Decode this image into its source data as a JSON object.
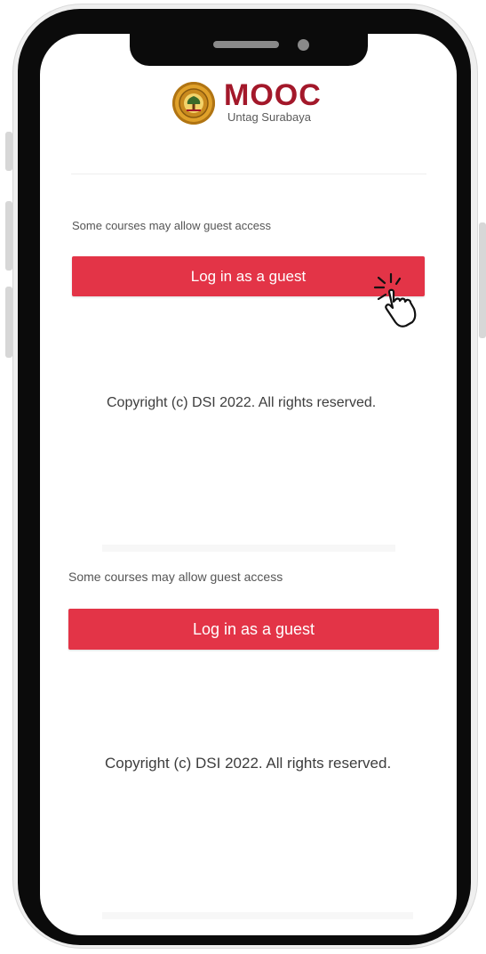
{
  "logo": {
    "title": "MOOC",
    "subtitle": "Untag Surabaya"
  },
  "top": {
    "guest_note": "Some courses may allow guest access",
    "guest_button": "Log in as a guest",
    "copyright": "Copyright (c) DSI 2022. All rights reserved."
  },
  "bottom": {
    "guest_note": "Some courses may allow guest access",
    "guest_button": "Log in as a guest",
    "copyright": "Copyright (c) DSI 2022. All rights reserved."
  },
  "colors": {
    "accent": "#e33447",
    "brand_text": "#a3182a"
  },
  "icons": {
    "logo": "university-emblem-icon",
    "cursor": "tap-hand-cursor-icon"
  }
}
